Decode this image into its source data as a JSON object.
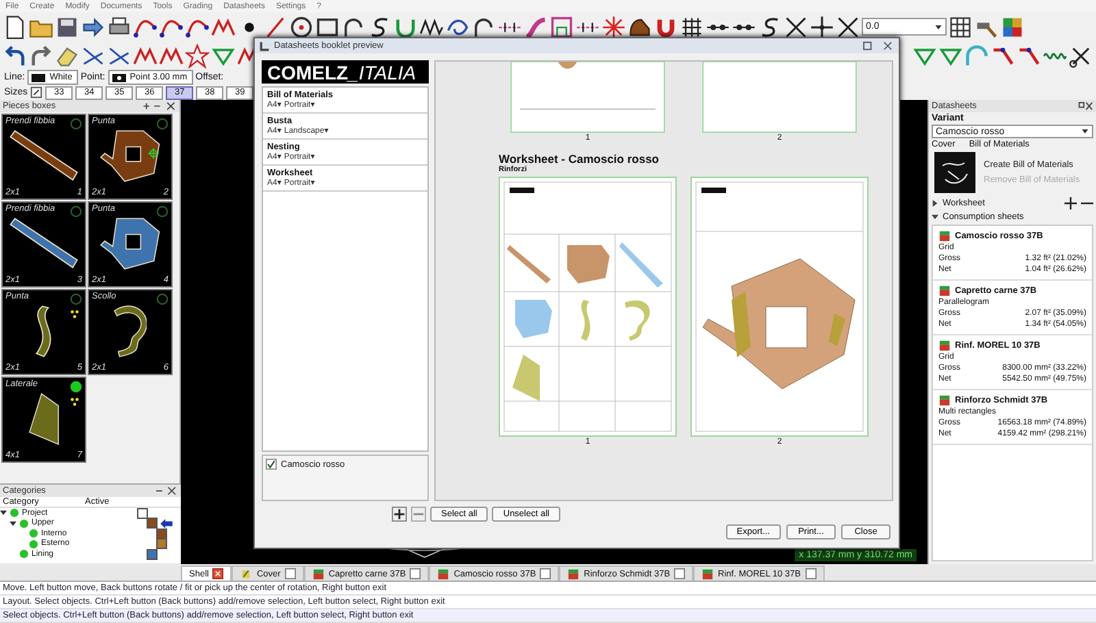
{
  "menu": [
    "File",
    "Create",
    "Modify",
    "Documents",
    "Tools",
    "Grading",
    "Datasheets",
    "Settings",
    "?"
  ],
  "toolbar": {
    "zoom_value": "0.0"
  },
  "properties": {
    "line_label": "Line:",
    "line_value": "White",
    "point_label": "Point:",
    "point_value": "Point 3.00 mm",
    "offset_label": "Offset:"
  },
  "sizes": {
    "label": "Sizes",
    "items": [
      {
        "label": "33",
        "selected": false
      },
      {
        "label": "34",
        "selected": false
      },
      {
        "label": "35",
        "selected": false
      },
      {
        "label": "36",
        "selected": false
      },
      {
        "label": "37",
        "selected": true
      },
      {
        "label": "38",
        "selected": false
      },
      {
        "label": "39",
        "selected": false
      }
    ]
  },
  "pieces_panel": {
    "title": "Pieces boxes",
    "pieces": [
      {
        "name": "Prendi fibbia",
        "count": "2x1",
        "number": "1",
        "kind": "strap",
        "color": "#7a3d12",
        "active": false,
        "marked": false,
        "anchor": false
      },
      {
        "name": "Punta",
        "count": "2x1",
        "number": "2",
        "kind": "vamp",
        "color": "#7a3d12",
        "active": false,
        "marked": false,
        "anchor": true
      },
      {
        "name": "Prendi fibbia",
        "count": "2x1",
        "number": "3",
        "kind": "strap",
        "color": "#3f73ad",
        "active": false,
        "marked": false,
        "anchor": false
      },
      {
        "name": "Punta",
        "count": "2x1",
        "number": "4",
        "kind": "vamp",
        "color": "#3f73ad",
        "active": false,
        "marked": false,
        "anchor": false
      },
      {
        "name": "Punta",
        "count": "2x1",
        "number": "5",
        "kind": "curve",
        "color": "#6b6b1c",
        "active": false,
        "marked": true,
        "anchor": false
      },
      {
        "name": "Scollo",
        "count": "2x1",
        "number": "6",
        "kind": "arc",
        "color": "#6b6b1c",
        "active": false,
        "marked": false,
        "anchor": false
      },
      {
        "name": "Laterale",
        "count": "4x1",
        "number": "7",
        "kind": "panel",
        "color": "#6b6b1c",
        "active": true,
        "marked": true,
        "anchor": false
      }
    ]
  },
  "categories": {
    "title": "Categories",
    "columns": [
      "Category",
      "Active"
    ],
    "tree": [
      {
        "label": "Project",
        "expanded": true,
        "color": "#ffffff",
        "current": false,
        "children": [
          {
            "label": "Upper",
            "expanded": true,
            "color": "#8a4a1a",
            "current": true,
            "children": [
              {
                "label": "Interno",
                "color": "#8a4a1a",
                "current": false
              },
              {
                "label": "Esterno",
                "color": "#b07a2a",
                "current": false
              }
            ]
          },
          {
            "label": "Lining",
            "color": "#3f73ad",
            "current": false
          }
        ]
      }
    ]
  },
  "dialog": {
    "title": "Datasheets booklet preview",
    "logo_bold": "COMELZ",
    "logo_light": "_ITALIA",
    "sections": [
      {
        "name": "Bill of Materials",
        "format": "A4▾",
        "orientation": "Portrait▾"
      },
      {
        "name": "Busta",
        "format": "A4▾",
        "orientation": "Landscape▾"
      },
      {
        "name": "Nesting",
        "format": "A4▾",
        "orientation": "Portrait▾"
      },
      {
        "name": "Worksheet",
        "format": "A4▾",
        "orientation": "Portrait▾"
      }
    ],
    "variants": [
      {
        "label": "Camoscio rosso",
        "checked": true
      }
    ],
    "top_pages": [
      "1",
      "2"
    ],
    "heading": "Worksheet - Camoscio rosso",
    "subheading": "Rinforzi",
    "pages": [
      {
        "number": "1",
        "kind": "grid"
      },
      {
        "number": "2",
        "kind": "detail"
      }
    ],
    "list_buttons": [
      "Select all",
      "Unselect all"
    ],
    "buttons": [
      "Export...",
      "Print...",
      "Close"
    ]
  },
  "coordinates": "x 137.37 mm  y 310.72 mm",
  "datasheets": {
    "title": "Datasheets",
    "variant_label": "Variant",
    "variant_value": "Camoscio rosso",
    "cover_label": "Cover",
    "bom_label": "Bill of Materials",
    "actions": [
      {
        "label": "Create Bill of Materials",
        "disabled": false
      },
      {
        "label": "Remove Bill of Materials",
        "disabled": true
      }
    ],
    "sections": [
      {
        "label": "Worksheet",
        "expanded": false
      },
      {
        "label": "Consumption sheets",
        "expanded": true
      }
    ],
    "consumption": [
      {
        "name": "Camoscio rosso 37B",
        "method": "Grid",
        "rows": [
          {
            "label": "Gross",
            "value": "1.32 ft² (21.02%)"
          },
          {
            "label": "Net",
            "value": "1.04 ft² (26.62%)"
          }
        ]
      },
      {
        "name": "Capretto carne 37B",
        "method": "Parallelogram",
        "rows": [
          {
            "label": "Gross",
            "value": "2.07 ft² (35.09%)"
          },
          {
            "label": "Net",
            "value": "1.34 ft² (54.05%)"
          }
        ]
      },
      {
        "name": "Rinf. MOREL 10 37B",
        "method": "Grid",
        "rows": [
          {
            "label": "Gross",
            "value": "8300.00 mm² (33.22%)"
          },
          {
            "label": "Net",
            "value": "5542.50 mm² (49.75%)"
          }
        ]
      },
      {
        "name": "Rinforzo Schmidt 37B",
        "method": "Multi rectangles",
        "rows": [
          {
            "label": "Gross",
            "value": "16563.18 mm² (74.89%)"
          },
          {
            "label": "Net",
            "value": "4159.42 mm² (298.21%)"
          }
        ]
      }
    ]
  },
  "tabs": [
    {
      "label": "Shell",
      "kind": "shell",
      "selected": true
    },
    {
      "label": "Cover",
      "kind": "cover",
      "selected": false,
      "checked": false
    },
    {
      "label": "Capretto carne 37B",
      "kind": "material",
      "selected": false,
      "checked": false
    },
    {
      "label": "Camoscio rosso 37B",
      "kind": "material",
      "selected": false,
      "checked": false
    },
    {
      "label": "Rinforzo Schmidt 37B",
      "kind": "material",
      "selected": false,
      "checked": false
    },
    {
      "label": "Rinf. MOREL 10 37B",
      "kind": "material",
      "selected": false,
      "checked": false
    }
  ],
  "status_lines": [
    "Move. Left button move, Back buttons rotate / fit or pick up the center of rotation, Right button exit",
    "Layout. Select objects. Ctrl+Left button (Back buttons) add/remove selection, Left button select, Right button exit",
    "Select objects. Ctrl+Left button (Back buttons) add/remove selection, Left button select, Right button exit"
  ]
}
